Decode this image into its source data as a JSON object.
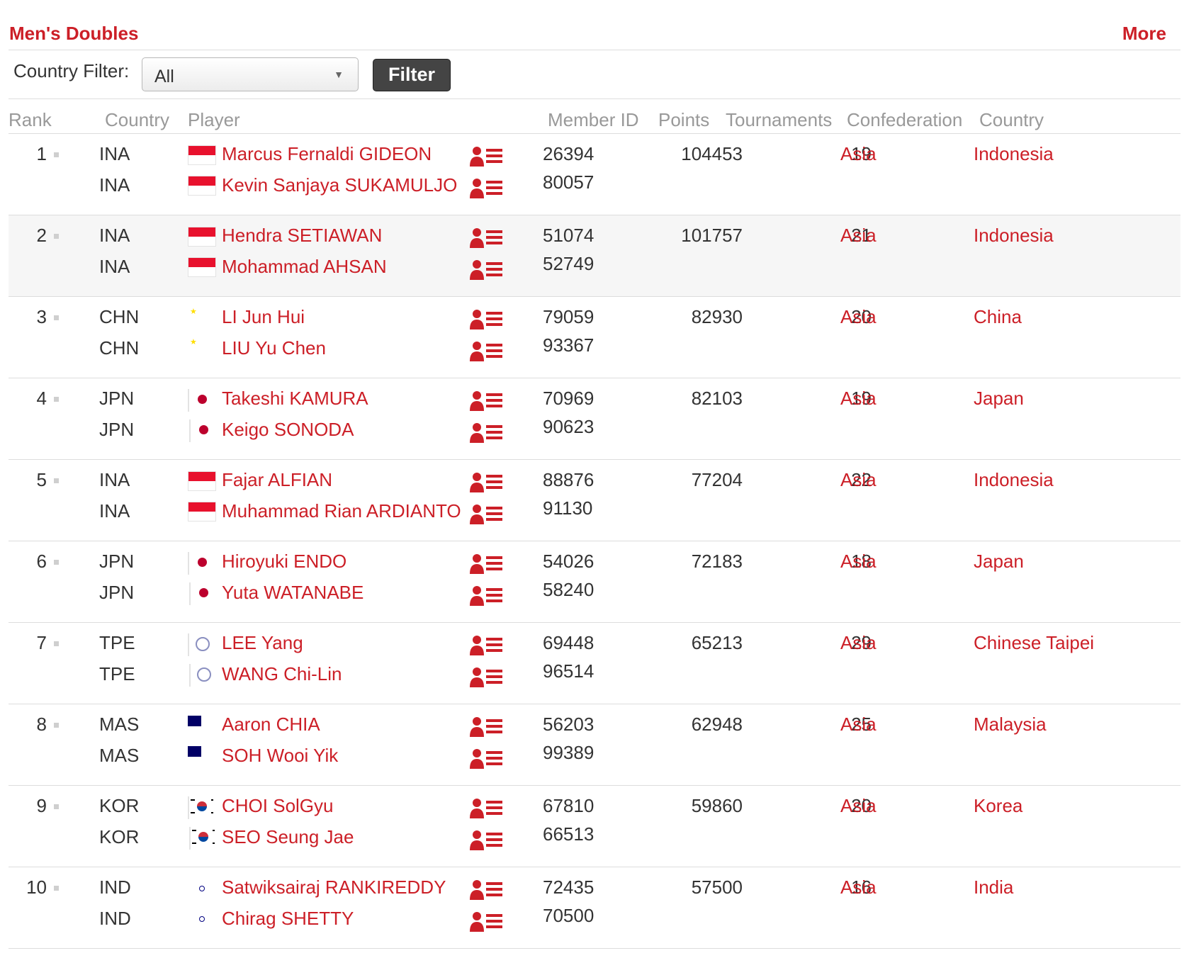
{
  "header": {
    "title": "Men's Doubles",
    "more": "More"
  },
  "filter": {
    "label": "Country Filter:",
    "selected": "All",
    "button": "Filter"
  },
  "columns": {
    "rank": "Rank",
    "country": "Country",
    "player": "Player",
    "member_id": "Member ID",
    "points": "Points",
    "tournaments": "Tournaments",
    "confederation": "Confederation",
    "country_name": "Country"
  },
  "colors": {
    "accent": "#cc1f27",
    "filter_button": "#444444",
    "alt_row": "#f6f6f6"
  },
  "icons": {
    "profile": "profile-list-icon",
    "rank_marker": "rank-marker-icon",
    "dropdown": "caret-down-icon"
  },
  "rows": [
    {
      "rank": "1",
      "points": "104453",
      "tournaments": "19",
      "confederation": "Asia",
      "country": "Indonesia",
      "players": [
        {
          "code": "INA",
          "name": "Marcus Fernaldi GIDEON",
          "member_id": "26394"
        },
        {
          "code": "INA",
          "name": "Kevin Sanjaya SUKAMULJO",
          "member_id": "80057"
        }
      ]
    },
    {
      "rank": "2",
      "points": "101757",
      "tournaments": "21",
      "confederation": "Asia",
      "country": "Indonesia",
      "players": [
        {
          "code": "INA",
          "name": "Hendra SETIAWAN",
          "member_id": "51074"
        },
        {
          "code": "INA",
          "name": "Mohammad AHSAN",
          "member_id": "52749"
        }
      ]
    },
    {
      "rank": "3",
      "points": "82930",
      "tournaments": "20",
      "confederation": "Asia",
      "country": "China",
      "players": [
        {
          "code": "CHN",
          "name": "LI Jun Hui",
          "member_id": "79059"
        },
        {
          "code": "CHN",
          "name": "LIU Yu Chen",
          "member_id": "93367"
        }
      ]
    },
    {
      "rank": "4",
      "points": "82103",
      "tournaments": "19",
      "confederation": "Asia",
      "country": "Japan",
      "players": [
        {
          "code": "JPN",
          "name": "Takeshi KAMURA",
          "member_id": "70969"
        },
        {
          "code": "JPN",
          "name": "Keigo SONODA",
          "member_id": "90623"
        }
      ]
    },
    {
      "rank": "5",
      "points": "77204",
      "tournaments": "22",
      "confederation": "Asia",
      "country": "Indonesia",
      "players": [
        {
          "code": "INA",
          "name": "Fajar ALFIAN",
          "member_id": "88876"
        },
        {
          "code": "INA",
          "name": "Muhammad Rian ARDIANTO",
          "member_id": "91130"
        }
      ]
    },
    {
      "rank": "6",
      "points": "72183",
      "tournaments": "18",
      "confederation": "Asia",
      "country": "Japan",
      "players": [
        {
          "code": "JPN",
          "name": "Hiroyuki ENDO",
          "member_id": "54026"
        },
        {
          "code": "JPN",
          "name": "Yuta WATANABE",
          "member_id": "58240"
        }
      ]
    },
    {
      "rank": "7",
      "points": "65213",
      "tournaments": "29",
      "confederation": "Asia",
      "country": "Chinese Taipei",
      "players": [
        {
          "code": "TPE",
          "name": "LEE Yang",
          "member_id": "69448"
        },
        {
          "code": "TPE",
          "name": "WANG Chi-Lin",
          "member_id": "96514"
        }
      ]
    },
    {
      "rank": "8",
      "points": "62948",
      "tournaments": "25",
      "confederation": "Asia",
      "country": "Malaysia",
      "players": [
        {
          "code": "MAS",
          "name": "Aaron CHIA",
          "member_id": "56203"
        },
        {
          "code": "MAS",
          "name": "SOH Wooi Yik",
          "member_id": "99389"
        }
      ]
    },
    {
      "rank": "9",
      "points": "59860",
      "tournaments": "20",
      "confederation": "Asia",
      "country": "Korea",
      "players": [
        {
          "code": "KOR",
          "name": "CHOI SolGyu",
          "member_id": "67810"
        },
        {
          "code": "KOR",
          "name": "SEO Seung Jae",
          "member_id": "66513"
        }
      ]
    },
    {
      "rank": "10",
      "points": "57500",
      "tournaments": "16",
      "confederation": "Asia",
      "country": "India",
      "players": [
        {
          "code": "IND",
          "name": "Satwiksairaj RANKIREDDY",
          "member_id": "72435"
        },
        {
          "code": "IND",
          "name": "Chirag SHETTY",
          "member_id": "70500"
        }
      ]
    }
  ]
}
